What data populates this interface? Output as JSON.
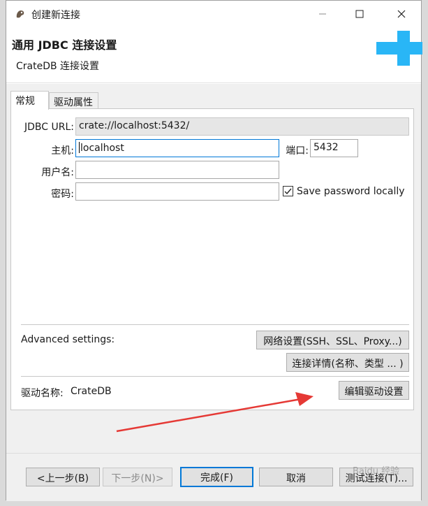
{
  "window": {
    "title": "创建新连接"
  },
  "header": {
    "title": "通用 JDBC 连接设置",
    "subtitle": "CrateDB 连接设置"
  },
  "tabs": [
    {
      "label": "常规",
      "active": true
    },
    {
      "label": "驱动属性",
      "active": false
    }
  ],
  "form": {
    "jdbc_url_label": "JDBC URL:",
    "jdbc_url_value": "crate://localhost:5432/",
    "host_label": "主机:",
    "host_value": "localhost",
    "port_label": "端口:",
    "port_value": "5432",
    "user_label": "用户名:",
    "user_value": "",
    "password_label": "密码:",
    "password_value": "",
    "save_password_label": "Save password locally",
    "save_password_checked": true
  },
  "advanced": {
    "label": "Advanced settings:",
    "network_button": "网络设置(SSH、SSL、Proxy...)",
    "details_button": "连接详情(名称、类型 ... )"
  },
  "driver": {
    "label": "驱动名称:",
    "name": "CrateDB",
    "edit_button": "编辑驱动设置"
  },
  "footer": {
    "back_button": "<上一步(B)",
    "next_button": "下一步(N)>",
    "finish_button": "完成(F)",
    "cancel_button": "取消",
    "test_button": "测试连接(T)..."
  },
  "colors": {
    "accent": "#0078d7",
    "banner_cross": "#29b6f6",
    "arrow": "#e53935"
  },
  "watermark": "Baidu 经验"
}
